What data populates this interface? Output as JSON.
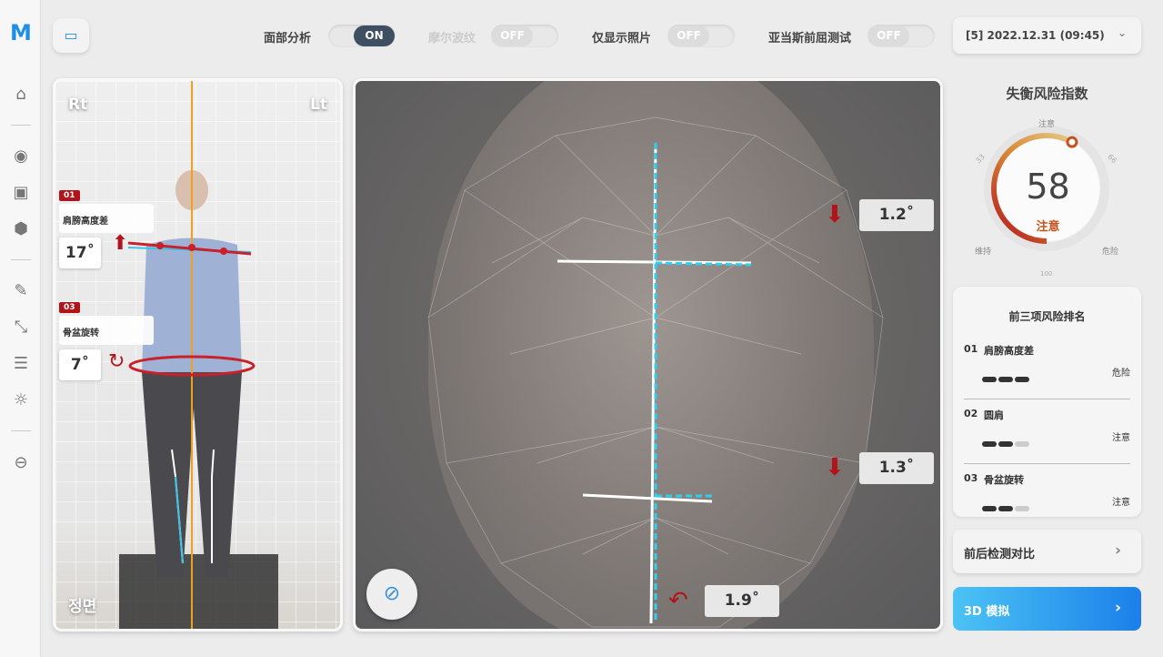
{
  "app": {
    "logo": "M"
  },
  "sidebar": {
    "icons": [
      "home-icon",
      "camera-icon",
      "photo-analysis-icon",
      "cube-icon",
      "report-icon",
      "compress-icon",
      "sliders-icon",
      "lightbulb-icon",
      "back-icon"
    ]
  },
  "toolbar": {
    "toggles": [
      {
        "label": "面部分析",
        "state": "ON"
      },
      {
        "label": "摩尔波纹",
        "state": "OFF"
      },
      {
        "label": "仅显示照片",
        "state": "OFF"
      },
      {
        "label": "亚当斯前屈测试",
        "state": "OFF"
      }
    ],
    "session": "[5] 2022.12.31 (09:45)"
  },
  "body_panel": {
    "right_label": "Rt",
    "left_label": "Lt",
    "view_label": "정면",
    "measures": [
      {
        "no": "01",
        "name": "肩膀高度差",
        "value": "17˚"
      },
      {
        "no": "03",
        "name": "骨盆旋转",
        "value": "7˚"
      }
    ]
  },
  "face_panel": {
    "angles": [
      "1.2˚",
      "1.3˚",
      "1.9˚"
    ]
  },
  "risk": {
    "title": "失衡风险指数",
    "score": "58",
    "level": "注意",
    "score_fraction": 0.58,
    "gauge_labels": {
      "top": "注意",
      "t33": "33",
      "t66": "66",
      "left": "维持",
      "right": "危险",
      "bottom": "100"
    },
    "colors": {
      "accent": "#c2541e",
      "danger": "#b1141b"
    }
  },
  "ranking": {
    "title": "前三项风险排名",
    "items": [
      {
        "no": "01",
        "name": "肩膀高度差",
        "level": "危险",
        "filled": 3
      },
      {
        "no": "02",
        "name": "圆肩",
        "level": "注意",
        "filled": 2
      },
      {
        "no": "03",
        "name": "骨盆旋转",
        "level": "注意",
        "filled": 2
      }
    ]
  },
  "buttons": {
    "compare": "前后检测对比",
    "sim3d": "3D 模拟"
  }
}
